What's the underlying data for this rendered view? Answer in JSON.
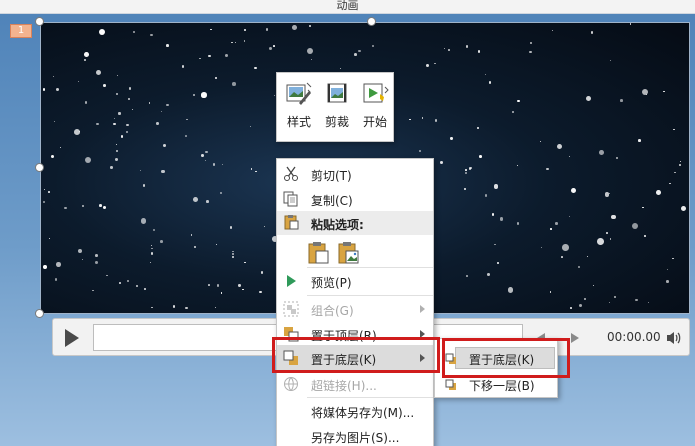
{
  "window": {
    "title": "动画"
  },
  "slide": {
    "number": "1"
  },
  "player": {
    "time": "00:00.00"
  },
  "mini_toolbar": {
    "buttons": [
      {
        "label": "样式",
        "icon": "video-style-icon"
      },
      {
        "label": "剪裁",
        "icon": "trim-icon"
      },
      {
        "label": "开始",
        "icon": "start-icon"
      }
    ]
  },
  "context_menu": {
    "items": [
      {
        "label": "剪切(T)",
        "icon": "scissors-icon"
      },
      {
        "label": "复制(C)",
        "icon": "copy-icon"
      },
      {
        "label": "粘贴选项:",
        "icon": "paste-icon"
      },
      {
        "label": "预览(P)",
        "icon": "preview-play-icon"
      },
      {
        "label": "组合(G)",
        "icon": "group-icon",
        "disabled": true
      },
      {
        "label": "置于顶层(R)",
        "icon": "bring-to-front-icon"
      },
      {
        "label": "置于底层(K)",
        "icon": "send-to-back-icon"
      },
      {
        "label": "超链接(H)...",
        "icon": "hyperlink-icon",
        "disabled": true
      },
      {
        "label": "将媒体另存为(M)..."
      },
      {
        "label": "另存为图片(S)..."
      }
    ]
  },
  "submenu": {
    "items": [
      {
        "label": "置于底层(K)"
      },
      {
        "label": "下移一层(B)"
      }
    ]
  },
  "colors": {
    "highlight_box": "#d01c1c",
    "menu_hover": "#dcdcdc"
  }
}
